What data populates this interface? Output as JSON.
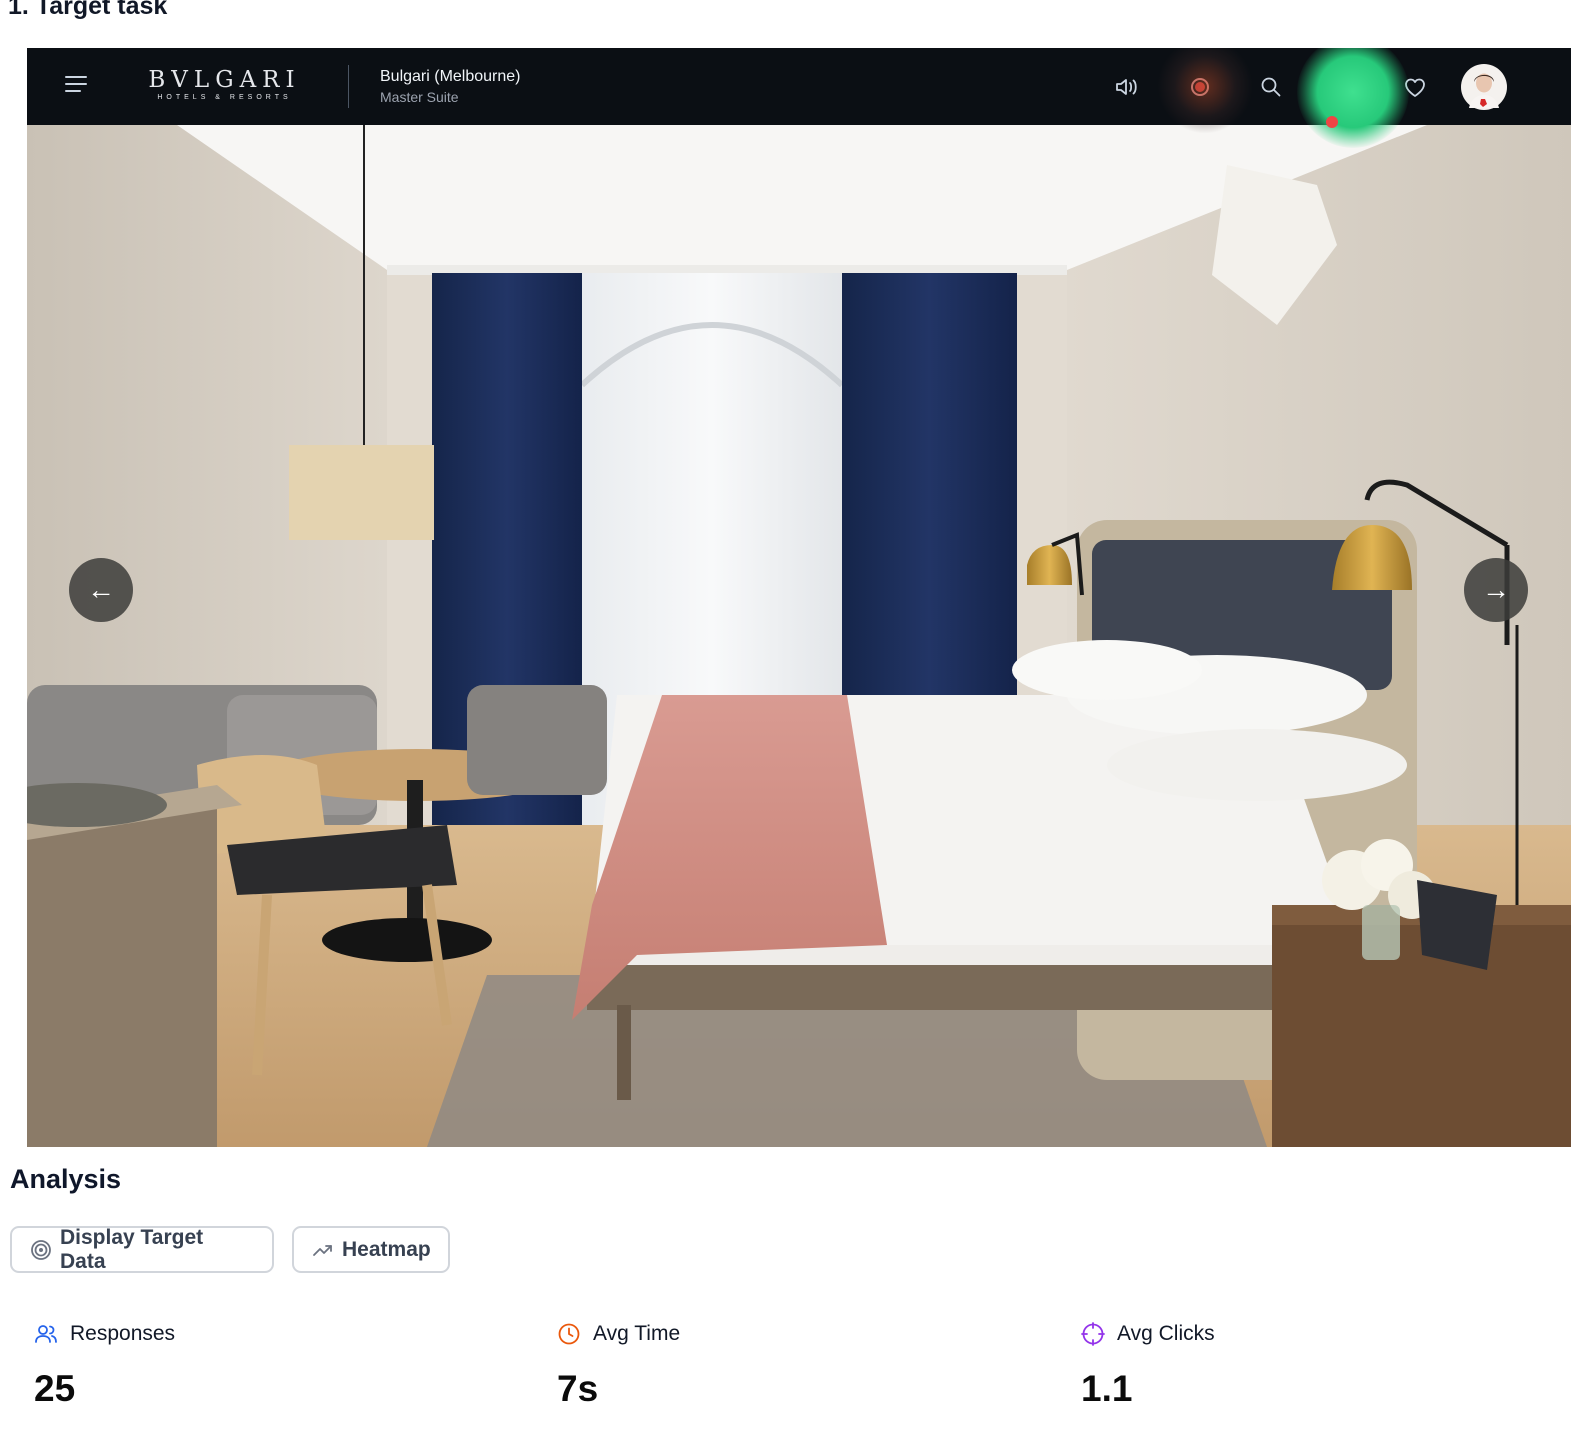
{
  "page": {
    "task_title": "1. Target task"
  },
  "preview": {
    "brand": {
      "name": "BVLGARI",
      "tagline": "HOTELS & RESORTS"
    },
    "hotel_name": "Bulgari (Melbourne)",
    "room_name": "Master Suite",
    "icons": [
      "menu-icon",
      "speaker-icon",
      "record-icon",
      "search-icon",
      "gallery-icon",
      "heart-icon",
      "avatar"
    ],
    "nav": {
      "prev": "←",
      "next": "→"
    },
    "heatmap_colors": {
      "hot": "#27c97a",
      "warm": "#c24a2a",
      "click": "#ef4444"
    }
  },
  "analysis": {
    "title": "Analysis",
    "buttons": {
      "target_data": "Display Target Data",
      "heatmap": "Heatmap"
    },
    "stats": [
      {
        "label": "Responses",
        "value": "25",
        "color": "#2563eb"
      },
      {
        "label": "Avg Time",
        "value": "7s",
        "color": "#ea580c"
      },
      {
        "label": "Avg Clicks",
        "value": "1.1",
        "color": "#9333ea"
      }
    ]
  }
}
